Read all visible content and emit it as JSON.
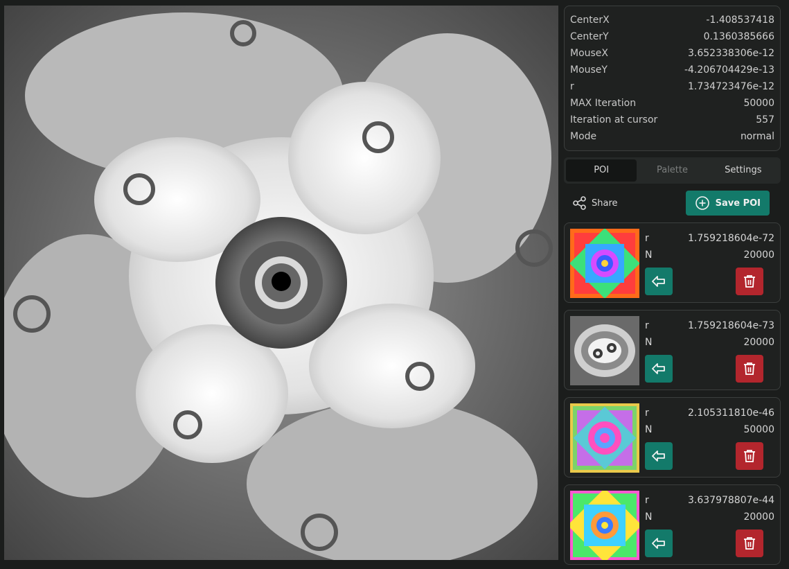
{
  "info": [
    {
      "label": "CenterX",
      "value": "-1.408537418"
    },
    {
      "label": "CenterY",
      "value": "0.1360385666"
    },
    {
      "label": "MouseX",
      "value": "3.652338306e-12"
    },
    {
      "label": "MouseY",
      "value": "-4.206704429e-13"
    },
    {
      "label": "r",
      "value": "1.734723476e-12"
    },
    {
      "label": "MAX Iteration",
      "value": "50000"
    },
    {
      "label": "Iteration at cursor",
      "value": "557"
    },
    {
      "label": "Mode",
      "value": "normal"
    }
  ],
  "tabs": [
    {
      "label": "POI",
      "state": "active"
    },
    {
      "label": "Palette",
      "state": "disabled"
    },
    {
      "label": "Settings",
      "state": "normal"
    }
  ],
  "actions": {
    "share_label": "Share",
    "save_label": "Save POI"
  },
  "pois": [
    {
      "r_label": "r",
      "r": "1.759218604e-72",
      "n_label": "N",
      "n": "20000",
      "thumb": "rainbow-orange"
    },
    {
      "r_label": "r",
      "r": "1.759218604e-73",
      "n_label": "N",
      "n": "20000",
      "thumb": "grayscale"
    },
    {
      "r_label": "r",
      "r": "2.105311810e-46",
      "n_label": "N",
      "n": "50000",
      "thumb": "rainbow-pink"
    },
    {
      "r_label": "r",
      "r": "3.637978807e-44",
      "n_label": "N",
      "n": "20000",
      "thumb": "rainbow-bright"
    }
  ],
  "colors": {
    "accent": "#137a6a",
    "danger": "#b3262d",
    "panel": "#1f2120",
    "background": "#1b1d1c"
  },
  "icons": {
    "share": "share-icon",
    "save": "plus-circle-icon",
    "load": "arrow-left-icon",
    "delete": "trash-icon"
  }
}
